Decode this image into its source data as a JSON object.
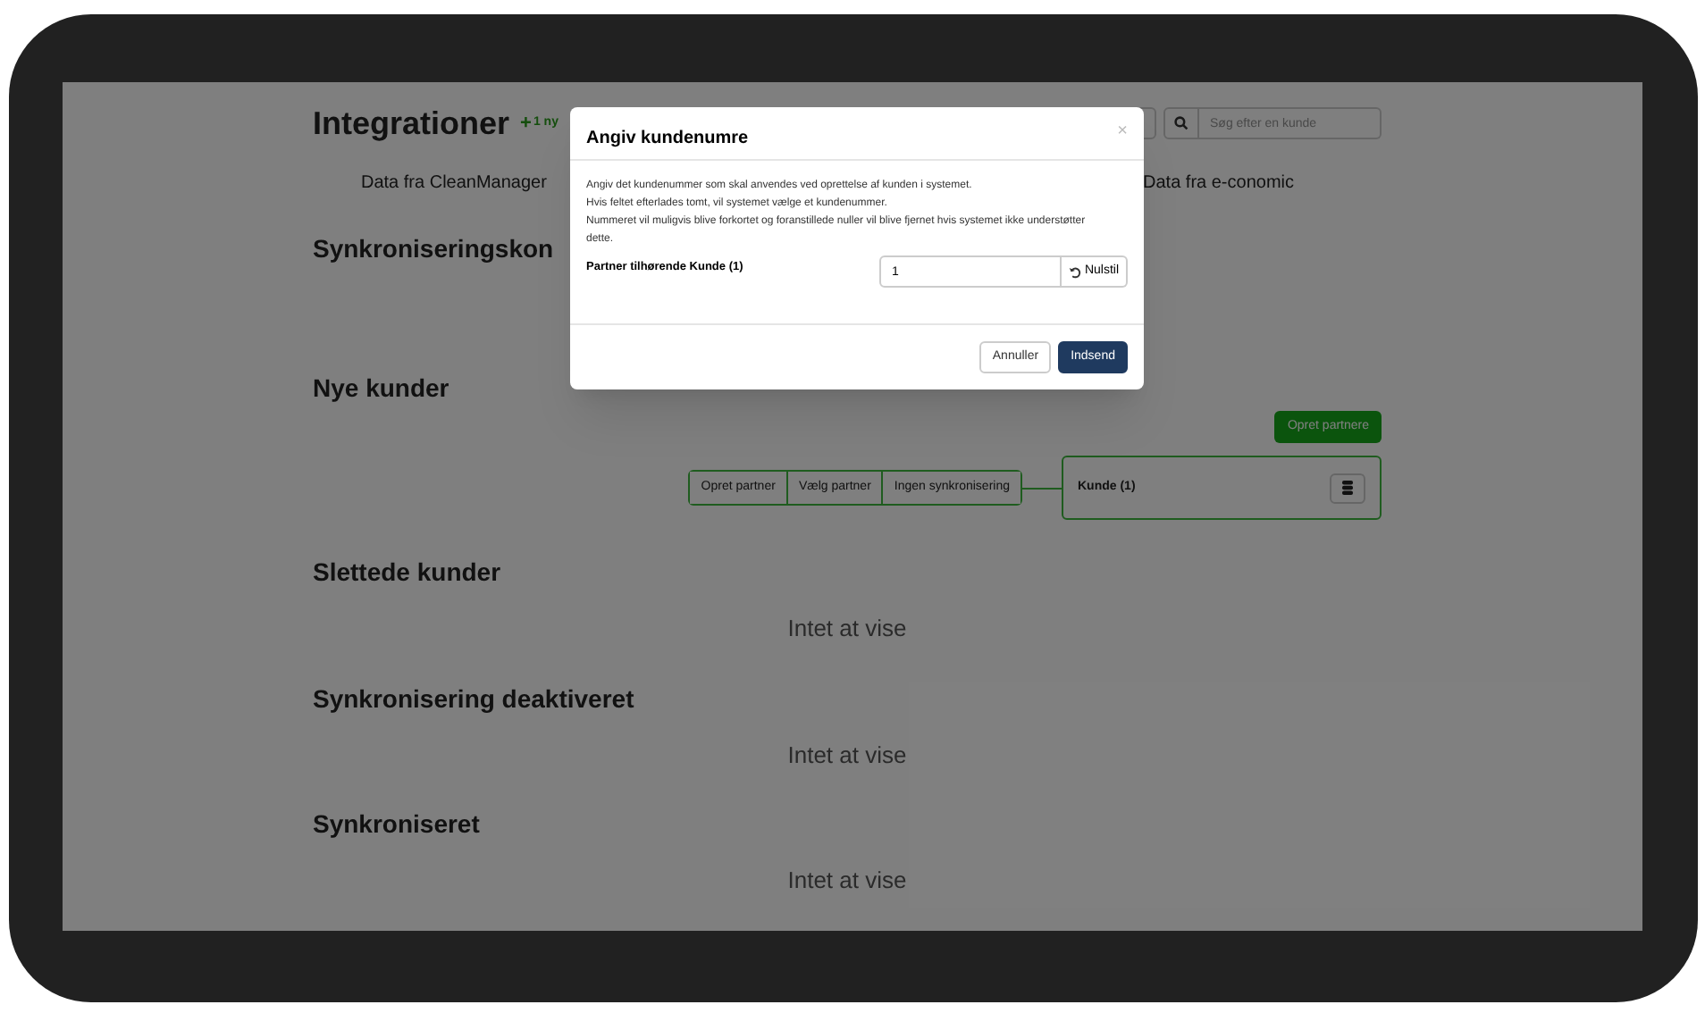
{
  "page": {
    "title": "Integrationer",
    "badge_icon": "+",
    "badge": "1 ny",
    "search": {
      "placeholder": "Søg efter en kunde"
    },
    "source_left": "Data fra CleanManager",
    "source_right": "Data fra e-conomic",
    "sections": [
      {
        "kind": "plain",
        "title": "Synkroniseringskon"
      },
      {
        "kind": "new",
        "title": "Nye kunder",
        "action": "Opret partnere",
        "options": [
          "Opret partner",
          "Vælg partner",
          "Ingen synkronisering"
        ],
        "customer": "Kunde (1)"
      },
      {
        "kind": "empty",
        "title": "Slettede kunder",
        "empty_text": "Intet at vise"
      },
      {
        "kind": "empty",
        "title": "Synkronisering deaktiveret",
        "empty_text": "Intet at vise"
      },
      {
        "kind": "empty",
        "title": "Synkroniseret",
        "empty_text": "Intet at vise"
      }
    ]
  },
  "dialog": {
    "title": "Angiv kundenumre",
    "close": "×",
    "description": [
      "Angiv det kundenummer som skal anvendes ved oprettelse af kunden i systemet.",
      "Hvis feltet efterlades tomt, vil systemet vælge et kundenummer.",
      "Nummeret vil muligvis blive forkortet og foranstillede nuller vil blive fjernet hvis systemet ikke understøtter dette."
    ],
    "field": {
      "label": "Partner tilhørende Kunde (1)",
      "value": "1",
      "reset": "Nulstil"
    },
    "buttons": [
      {
        "kind": "default",
        "label": "Annuller"
      },
      {
        "kind": "primary",
        "label": "Indsend"
      }
    ]
  }
}
